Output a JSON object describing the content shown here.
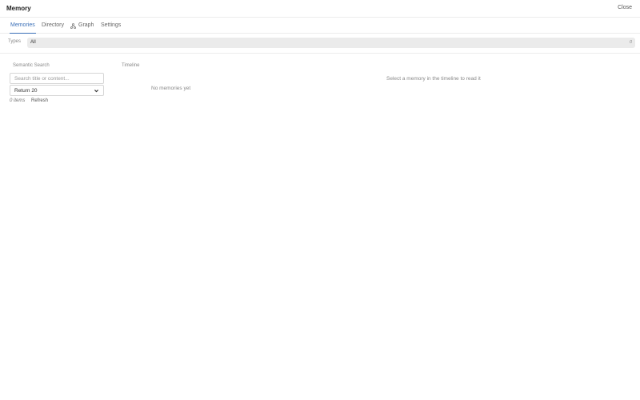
{
  "window": {
    "title": "Memory",
    "close_label": "Close"
  },
  "tabs": [
    {
      "label": "Memories",
      "active": true
    },
    {
      "label": "Directory",
      "active": false
    },
    {
      "label": "Graph",
      "active": false,
      "icon": "graph-icon"
    },
    {
      "label": "Settings",
      "active": false
    }
  ],
  "types": {
    "label": "Types",
    "selected": "All",
    "count": "0"
  },
  "search": {
    "label": "Semantic Search",
    "placeholder": "Search title or content...",
    "value": "",
    "return_selected": "Return 20"
  },
  "list": {
    "count_label": "0 items",
    "refresh_label": "Refresh"
  },
  "timeline": {
    "label": "Timeline",
    "empty_message": "No memories yet"
  },
  "detail": {
    "hint": "Select a memory in the timeline to read it"
  },
  "colors": {
    "accent": "#3a6fb7"
  }
}
